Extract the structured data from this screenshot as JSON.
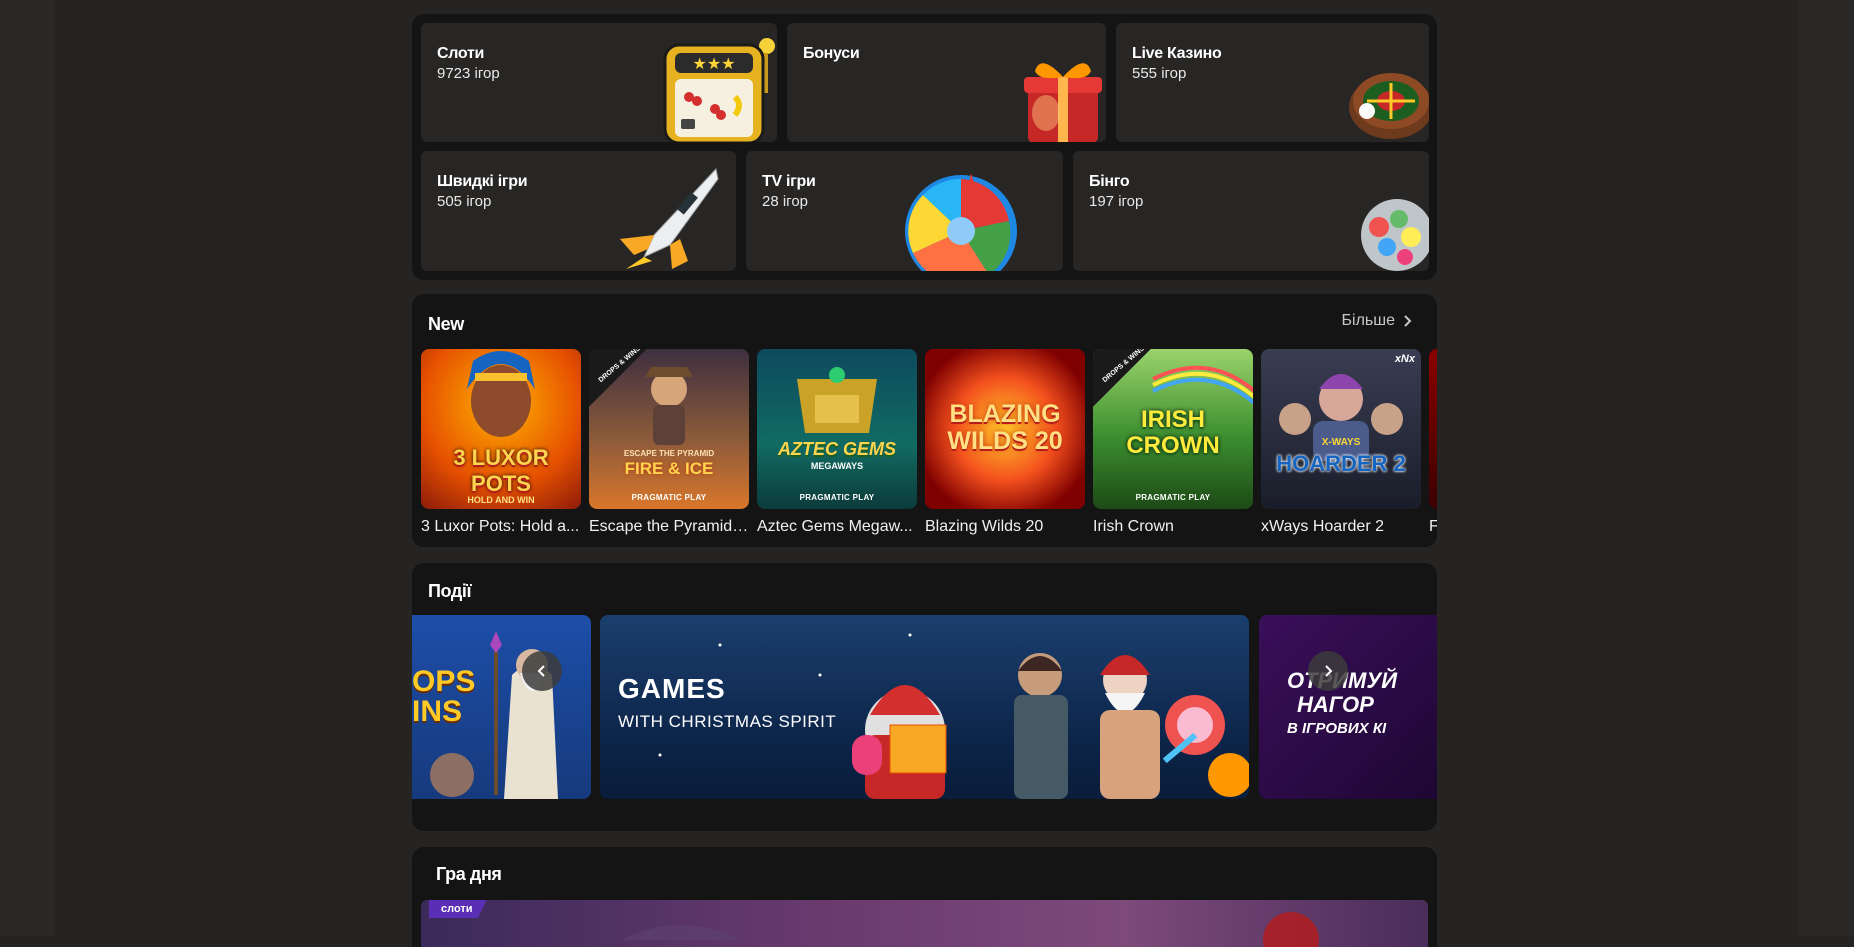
{
  "categories": [
    {
      "title": "Слоти",
      "count": "9723 ігор"
    },
    {
      "title": "Бонуси",
      "count": ""
    },
    {
      "title": "Live Казино",
      "count": "555 ігор"
    },
    {
      "title": "Швидкі ігри",
      "count": "505 ігор"
    },
    {
      "title": "TV ігри",
      "count": "28 ігор"
    },
    {
      "title": "Бінго",
      "count": "197 ігор"
    }
  ],
  "new_section": {
    "title": "New",
    "more_label": "Більше",
    "games": [
      {
        "name": "3 Luxor Pots: Hold a...",
        "art": "3 LUXOR POTS",
        "sub": "HOLD AND WIN"
      },
      {
        "name": "Escape the Pyramid -...",
        "art": "FIRE & ICE",
        "sub": "ESCAPE THE PYRAMID",
        "provider": "PRAGMATIC PLAY",
        "badge": "DROPS & WINS"
      },
      {
        "name": "Aztec Gems Megaw...",
        "art": "AZTEC GEMS",
        "sub": "MEGAWAYS",
        "provider": "PRAGMATIC PLAY"
      },
      {
        "name": "Blazing Wilds 20",
        "art": "BLAZING WILDS 20"
      },
      {
        "name": "Irish Crown",
        "art": "IRISH CROWN",
        "provider": "PRAGMATIC PLAY",
        "badge": "DROPS & WINS"
      },
      {
        "name": "xWays Hoarder 2",
        "art": "HOARDER 2",
        "sub": "X-WAYS",
        "tag": "xNx"
      },
      {
        "name": "F"
      }
    ]
  },
  "events_section": {
    "title": "Події",
    "banners": [
      {
        "line1": "OPS",
        "line2": "INS"
      },
      {
        "headline": "GAMES",
        "subline": "WITH CHRISTMAS SPIRIT"
      },
      {
        "line1": "ОТРИМУЙ",
        "line2": "НАГОР",
        "line3": "В ІГРОВИХ КІ"
      }
    ]
  },
  "game_of_day": {
    "title": "Гра дня",
    "tag": "слоти"
  },
  "icons": {
    "chevron": "chevron-right-icon",
    "prev": "chevron-left-icon",
    "next": "chevron-right-icon"
  }
}
